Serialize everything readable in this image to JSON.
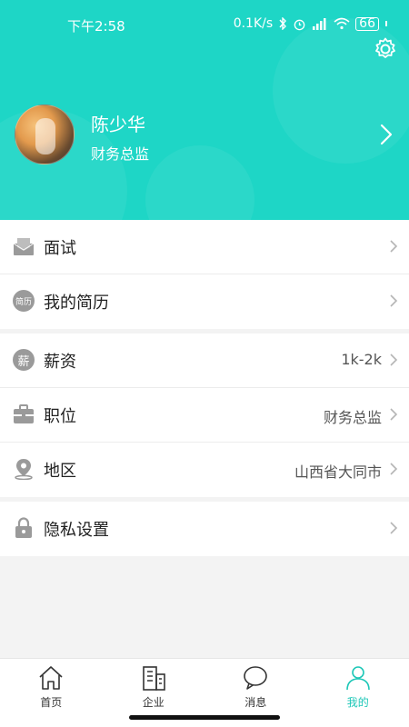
{
  "status_bar": {
    "time": "下午2:58",
    "network_speed": "0.1K/s",
    "battery": "66"
  },
  "profile": {
    "name": "陈少华",
    "title": "财务总监"
  },
  "menu": {
    "interview": {
      "label": "面试"
    },
    "resume": {
      "label": "我的简历",
      "badge": "简历"
    },
    "salary": {
      "label": "薪资",
      "value": "1k-2k",
      "badge": "薪"
    },
    "position": {
      "label": "职位",
      "value": "财务总监"
    },
    "region": {
      "label": "地区",
      "value": "山西省大同市"
    },
    "privacy": {
      "label": "隐私设置"
    }
  },
  "tabbar": {
    "home": "首页",
    "company": "企业",
    "messages": "消息",
    "me": "我的"
  },
  "colors": {
    "header_bg": "#1ed6c6",
    "active_tab": "#1ec7b7",
    "icon_gray": "#9a9a9a"
  }
}
